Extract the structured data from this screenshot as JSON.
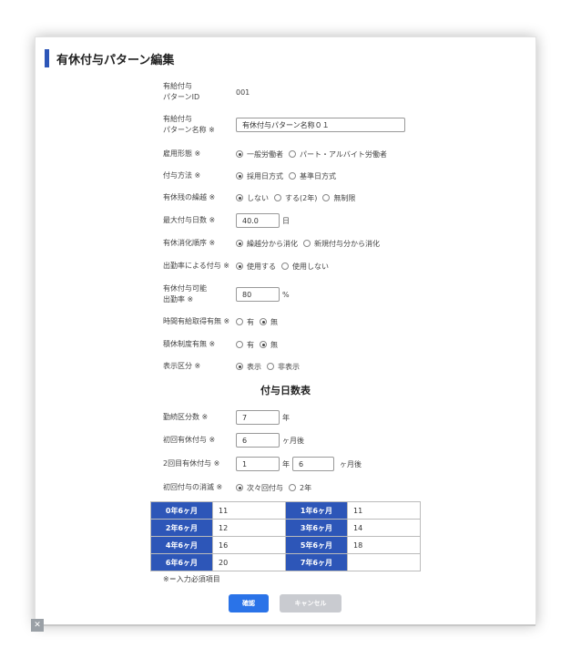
{
  "title": "有休付与パターン編集",
  "form": {
    "pattern_id": {
      "label_l1": "有給付与",
      "label_l2": "パターンID",
      "value": "001"
    },
    "pattern_name": {
      "label_l1": "有給付与",
      "label_l2": "パターン名称 ※",
      "value": "有休付与パターン名称０１"
    },
    "employment_type": {
      "label": "雇用形態 ※",
      "options": [
        "一般労働者",
        "パート・アルバイト労働者"
      ],
      "selected": 0
    },
    "grant_method": {
      "label": "付与方法 ※",
      "options": [
        "採用日方式",
        "基準日方式"
      ],
      "selected": 0
    },
    "carryover": {
      "label": "有休残の繰越 ※",
      "options": [
        "しない",
        "する(2年)",
        "無制限"
      ],
      "selected": 0
    },
    "max_days": {
      "label": "最大付与日数 ※",
      "value": "40.0",
      "unit": "日"
    },
    "consume_order": {
      "label": "有休消化順序 ※",
      "options": [
        "繰越分から消化",
        "新規付与分から消化"
      ],
      "selected": 0
    },
    "attendance_grant": {
      "label": "出勤率による付与 ※",
      "options": [
        "使用する",
        "使用しない"
      ],
      "selected": 0
    },
    "attendance_rate": {
      "label_l1": "有休付与可能",
      "label_l2": "出勤率 ※",
      "value": "80",
      "unit": "%"
    },
    "hourly_leave": {
      "label": "時間有給取得有無 ※",
      "options": [
        "有",
        "無"
      ],
      "selected": 1
    },
    "special_system": {
      "label": "積休制度有無 ※",
      "options": [
        "有",
        "無"
      ],
      "selected": 1
    },
    "display": {
      "label": "表示区分 ※",
      "options": [
        "表示",
        "非表示"
      ],
      "selected": 0
    }
  },
  "section_title": "付与日数表",
  "days_form": {
    "work_category": {
      "label": "勤続区分数 ※",
      "value": "7",
      "unit": "年"
    },
    "first_grant": {
      "label": "初回有休付与 ※",
      "value": "6",
      "unit": "ヶ月後"
    },
    "second_grant": {
      "label": "2回目有休付与 ※",
      "value_years": "1",
      "unit_years": "年",
      "value_months": "6",
      "unit_months": "ヶ月後"
    },
    "first_expiry": {
      "label": "初回付与の消滅 ※",
      "options": [
        "次々回付与",
        "2年"
      ],
      "selected": 0
    }
  },
  "table": {
    "rows": [
      [
        {
          "h": "0年6ヶ月",
          "v": "11"
        },
        {
          "h": "1年6ヶ月",
          "v": "11"
        }
      ],
      [
        {
          "h": "2年6ヶ月",
          "v": "12"
        },
        {
          "h": "3年6ヶ月",
          "v": "14"
        }
      ],
      [
        {
          "h": "4年6ヶ月",
          "v": "16"
        },
        {
          "h": "5年6ヶ月",
          "v": "18"
        }
      ],
      [
        {
          "h": "6年6ヶ月",
          "v": "20"
        },
        {
          "h": "7年6ヶ月",
          "v": ""
        }
      ]
    ]
  },
  "note": "※＝入力必須項目",
  "buttons": {
    "confirm": "確認",
    "cancel": "キャンセル"
  },
  "colors": {
    "accent": "#2d56b8",
    "confirm": "#2a73e8",
    "cancel": "#c9cbd0"
  }
}
